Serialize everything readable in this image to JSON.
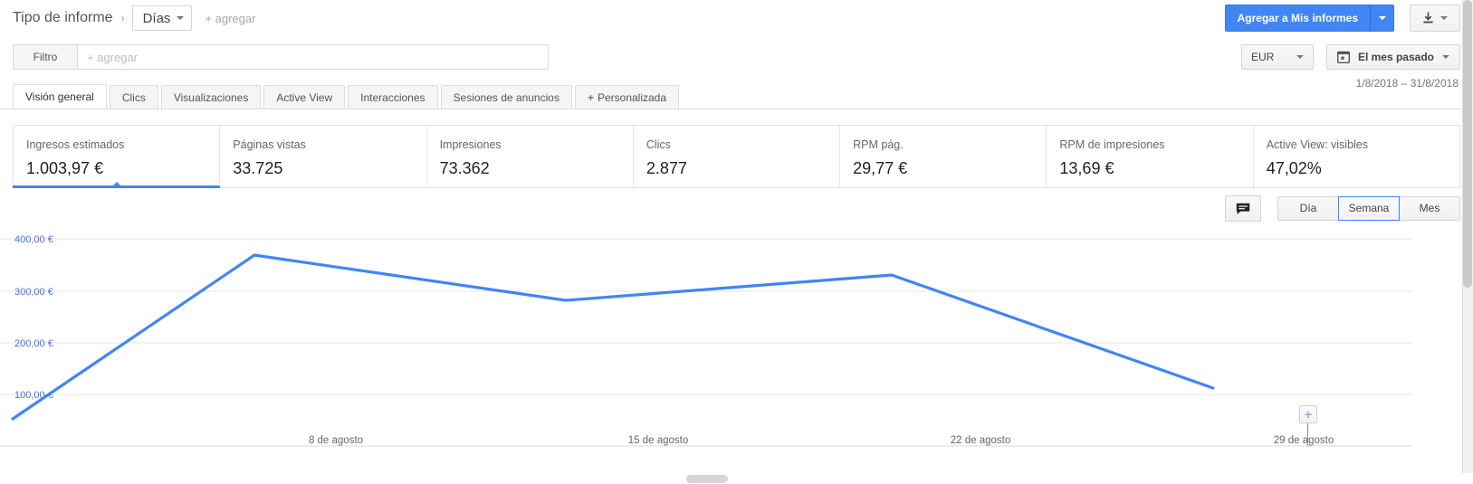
{
  "breadcrumb": {
    "title": "Tipo de informe",
    "separator": "›",
    "dimension_chip": "Días",
    "add_link": "+ agregar"
  },
  "top_actions": {
    "primary_button": "Agregar a Mis informes",
    "download_icon": "download-icon"
  },
  "filter": {
    "label": "Filtro",
    "placeholder": "+ agregar",
    "value": ""
  },
  "right_controls": {
    "currency": "EUR",
    "date_preset": "El mes pasado",
    "date_range": "1/8/2018 – 31/8/2018",
    "calendar_icon": "calendar-icon"
  },
  "tabs": [
    {
      "label": "Visión general",
      "active": true
    },
    {
      "label": "Clics",
      "active": false
    },
    {
      "label": "Visualizaciones",
      "active": false
    },
    {
      "label": "Active View",
      "active": false
    },
    {
      "label": "Interacciones",
      "active": false
    },
    {
      "label": "Sesiones de anuncios",
      "active": false
    },
    {
      "label": "Personalizada",
      "active": false,
      "plus": "+"
    }
  ],
  "metric_cards": [
    {
      "label": "Ingresos estimados",
      "value": "1.003,97 €",
      "selected": true
    },
    {
      "label": "Páginas vistas",
      "value": "33.725",
      "selected": false
    },
    {
      "label": "Impresiones",
      "value": "73.362",
      "selected": false
    },
    {
      "label": "Clics",
      "value": "2.877",
      "selected": false
    },
    {
      "label": "RPM pág.",
      "value": "29,77 €",
      "selected": false
    },
    {
      "label": "RPM de impresiones",
      "value": "13,69 €",
      "selected": false
    },
    {
      "label": "Active View: visibles",
      "value": "47,02%",
      "selected": false
    }
  ],
  "chart_controls": {
    "note_icon": "note-icon",
    "granularity": [
      {
        "label": "Día",
        "active": false
      },
      {
        "label": "Semana",
        "active": true
      },
      {
        "label": "Mes",
        "active": false
      }
    ]
  },
  "annotation": {
    "icon": "plus-icon",
    "label": "+"
  },
  "colors": {
    "accent": "#4285f4",
    "line": "#4285f4",
    "axis_label": "#4a6fe0"
  },
  "chart_data": {
    "type": "line",
    "title": "Ingresos estimados",
    "xlabel": "",
    "ylabel": "",
    "ylim": [
      0,
      450
    ],
    "grid": true,
    "legend": "none",
    "ytick_labels": [
      "400,00 €",
      "300,00 €",
      "200,00 €",
      "100,00 €"
    ],
    "ytick_values": [
      400,
      300,
      200,
      100
    ],
    "xtick_labels": [
      "8 de agosto",
      "15 de agosto",
      "22 de agosto",
      "29 de agosto"
    ],
    "xtick_values": [
      "2018-08-08",
      "2018-08-15",
      "2018-08-22",
      "2018-08-29"
    ],
    "series": [
      {
        "name": "Ingresos estimados",
        "color": "#4285f4",
        "x": [
          "2018-08-01",
          "2018-08-08",
          "2018-08-15",
          "2018-08-22",
          "2018-08-29"
        ],
        "values": [
          52,
          368,
          281,
          330,
          112
        ]
      }
    ]
  }
}
